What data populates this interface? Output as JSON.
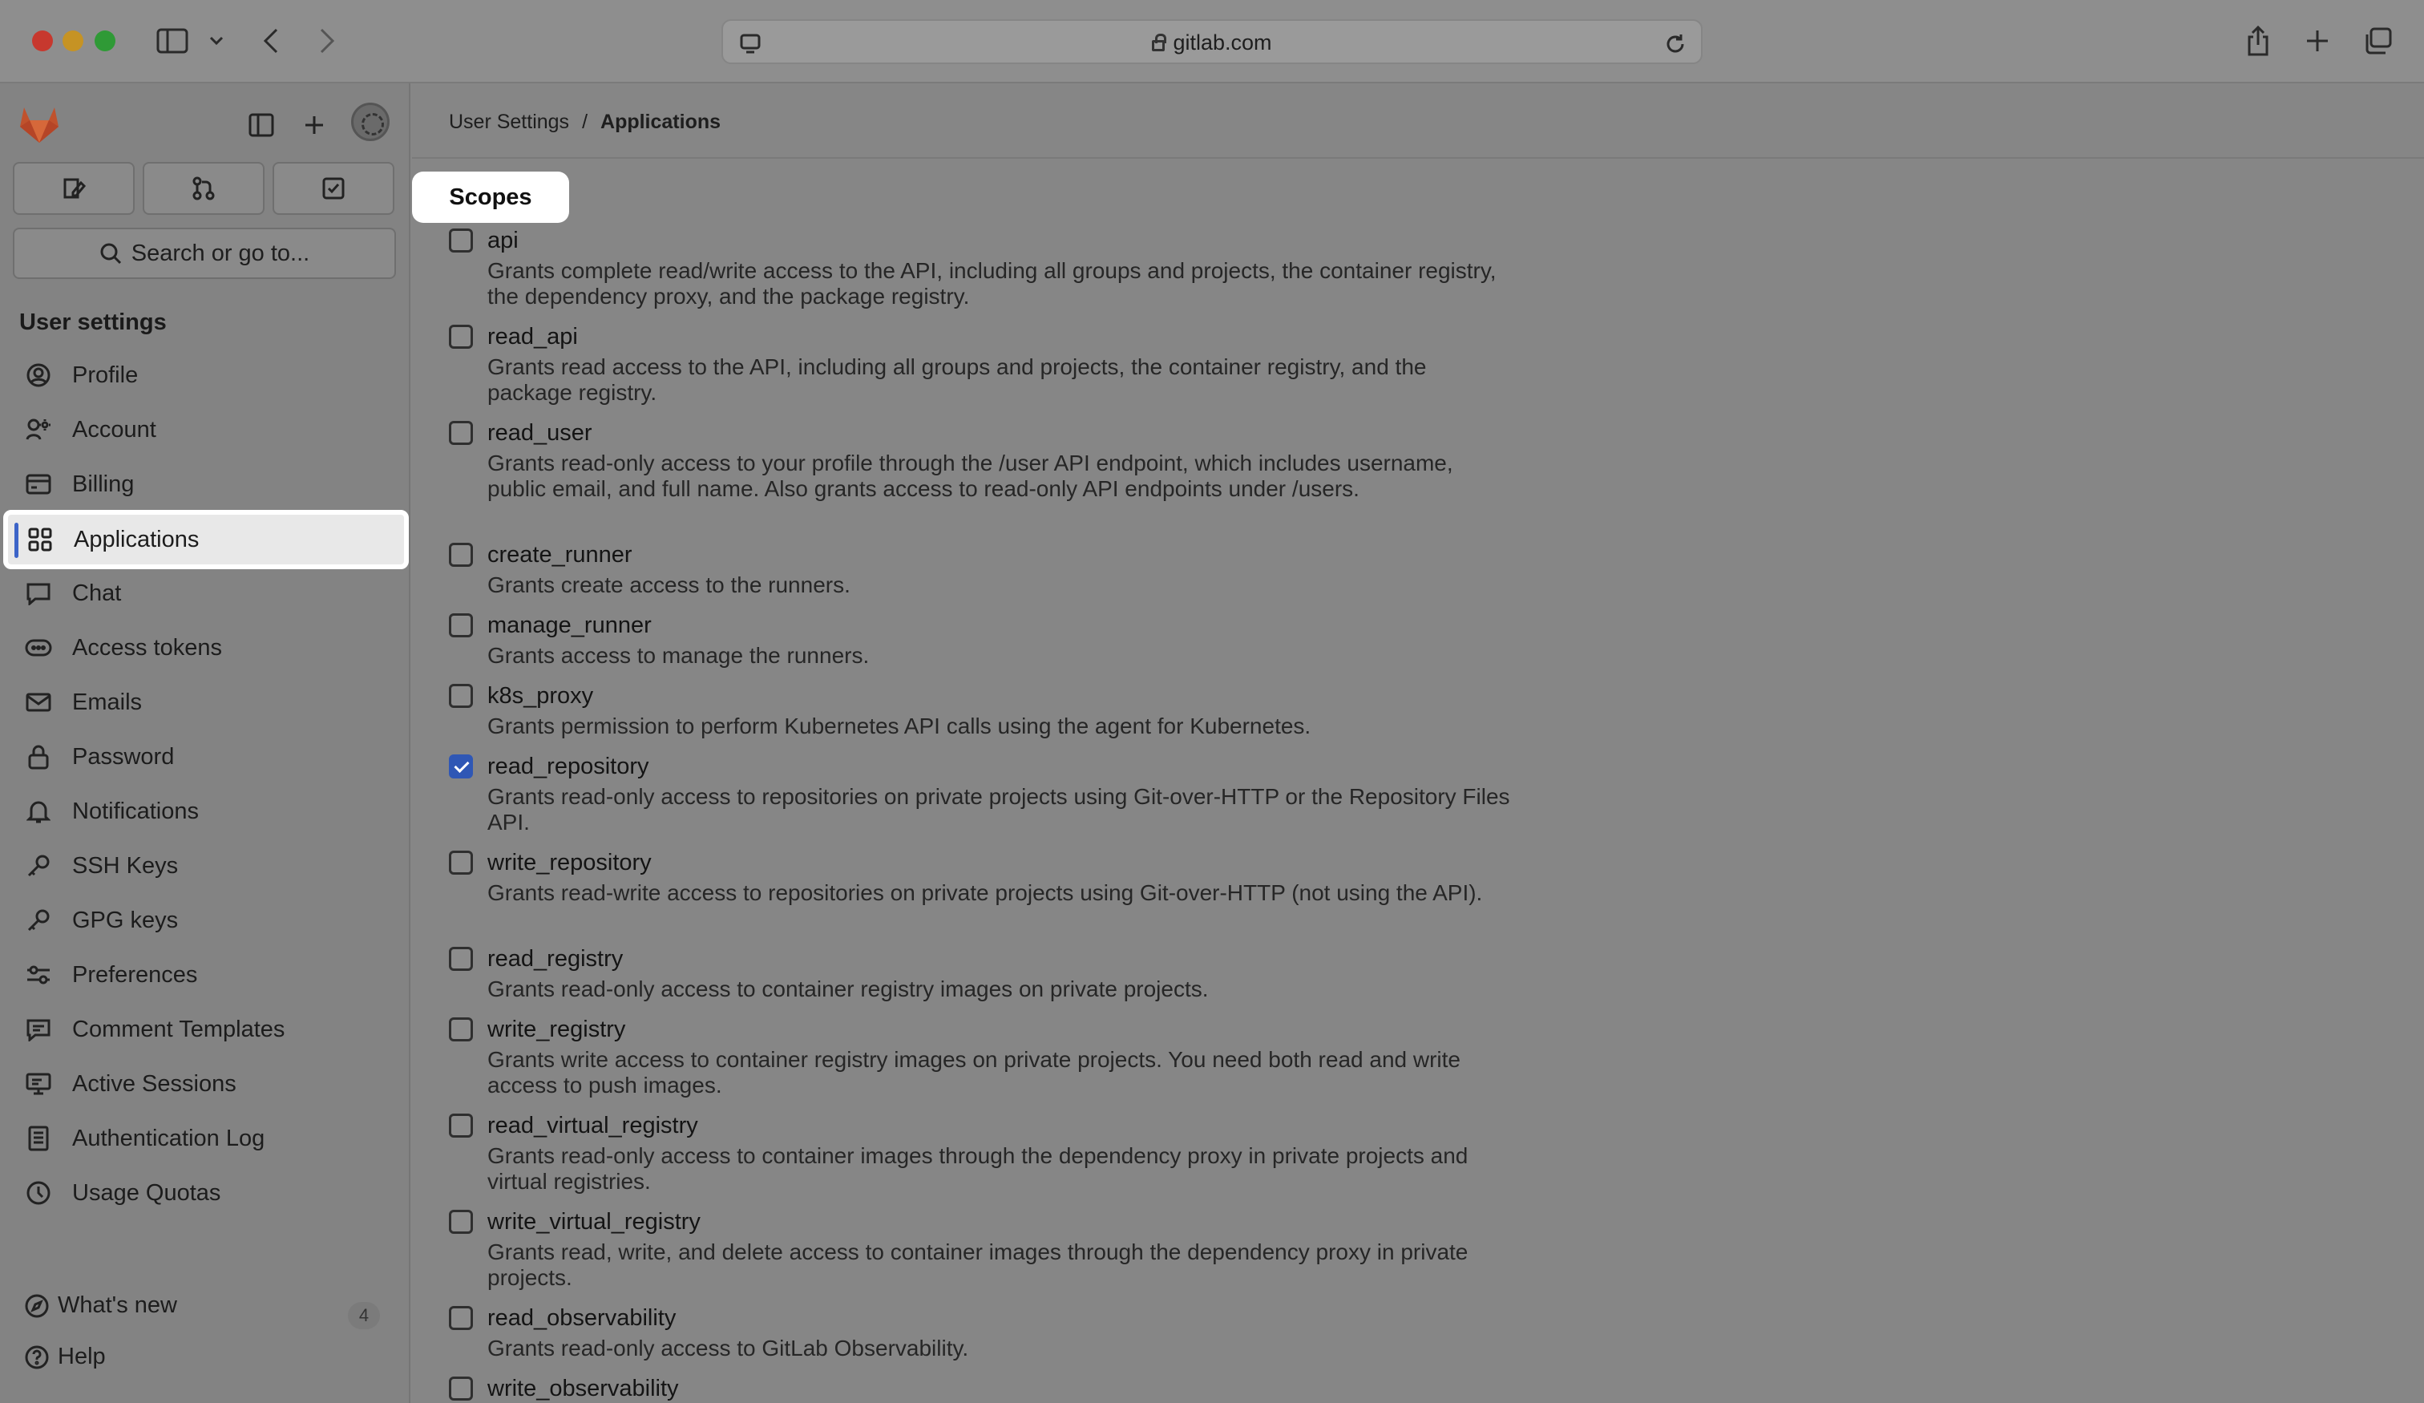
{
  "browser": {
    "url": "gitlab.com"
  },
  "sidebar": {
    "search_placeholder": "Search or go to...",
    "heading": "User settings",
    "items": [
      {
        "label": "Profile",
        "icon": "profile-icon"
      },
      {
        "label": "Account",
        "icon": "account-icon"
      },
      {
        "label": "Billing",
        "icon": "billing-icon"
      },
      {
        "label": "Applications",
        "icon": "applications-icon",
        "active": true
      },
      {
        "label": "Chat",
        "icon": "chat-icon"
      },
      {
        "label": "Access tokens",
        "icon": "token-icon"
      },
      {
        "label": "Emails",
        "icon": "mail-icon"
      },
      {
        "label": "Password",
        "icon": "lock-icon"
      },
      {
        "label": "Notifications",
        "icon": "bell-icon"
      },
      {
        "label": "SSH Keys",
        "icon": "key-icon"
      },
      {
        "label": "GPG keys",
        "icon": "key-icon"
      },
      {
        "label": "Preferences",
        "icon": "preferences-icon"
      },
      {
        "label": "Comment Templates",
        "icon": "comment-icon"
      },
      {
        "label": "Active Sessions",
        "icon": "monitor-icon"
      },
      {
        "label": "Authentication Log",
        "icon": "log-icon"
      },
      {
        "label": "Usage Quotas",
        "icon": "quota-icon"
      }
    ],
    "whats_new": "What's new",
    "whats_new_count": "4",
    "help": "Help"
  },
  "breadcrumb": {
    "parent": "User Settings",
    "separator": "/",
    "current": "Applications"
  },
  "scopes": {
    "title": "Scopes",
    "items": [
      {
        "name": "api",
        "checked": false,
        "desc": "Grants complete read/write access to the API, including all groups and projects, the container registry, the dependency proxy, and the package registry."
      },
      {
        "name": "read_api",
        "checked": false,
        "desc": "Grants read access to the API, including all groups and projects, the container registry, and the package registry."
      },
      {
        "name": "read_user",
        "checked": false,
        "desc": "Grants read-only access to your profile through the /user API endpoint, which includes username, public email, and full name. Also grants access to read-only API endpoints under /users."
      },
      {
        "name": "create_runner",
        "checked": false,
        "desc": "Grants create access to the runners."
      },
      {
        "name": "manage_runner",
        "checked": false,
        "desc": "Grants access to manage the runners."
      },
      {
        "name": "k8s_proxy",
        "checked": false,
        "desc": "Grants permission to perform Kubernetes API calls using the agent for Kubernetes."
      },
      {
        "name": "read_repository",
        "checked": true,
        "desc": "Grants read-only access to repositories on private projects using Git-over-HTTP or the Repository Files API."
      },
      {
        "name": "write_repository",
        "checked": false,
        "desc": "Grants read-write access to repositories on private projects using Git-over-HTTP (not using the API)."
      },
      {
        "name": "read_registry",
        "checked": false,
        "desc": "Grants read-only access to container registry images on private projects."
      },
      {
        "name": "write_registry",
        "checked": false,
        "desc": "Grants write access to container registry images on private projects. You need both read and write access to push images."
      },
      {
        "name": "read_virtual_registry",
        "checked": false,
        "desc": "Grants read-only access to container images through the dependency proxy in private projects and virtual registries."
      },
      {
        "name": "write_virtual_registry",
        "checked": false,
        "desc": "Grants read, write, and delete access to container images through the dependency proxy in private projects."
      },
      {
        "name": "read_observability",
        "checked": false,
        "desc": "Grants read-only access to GitLab Observability."
      },
      {
        "name": "write_observability",
        "checked": false,
        "desc": ""
      }
    ]
  }
}
